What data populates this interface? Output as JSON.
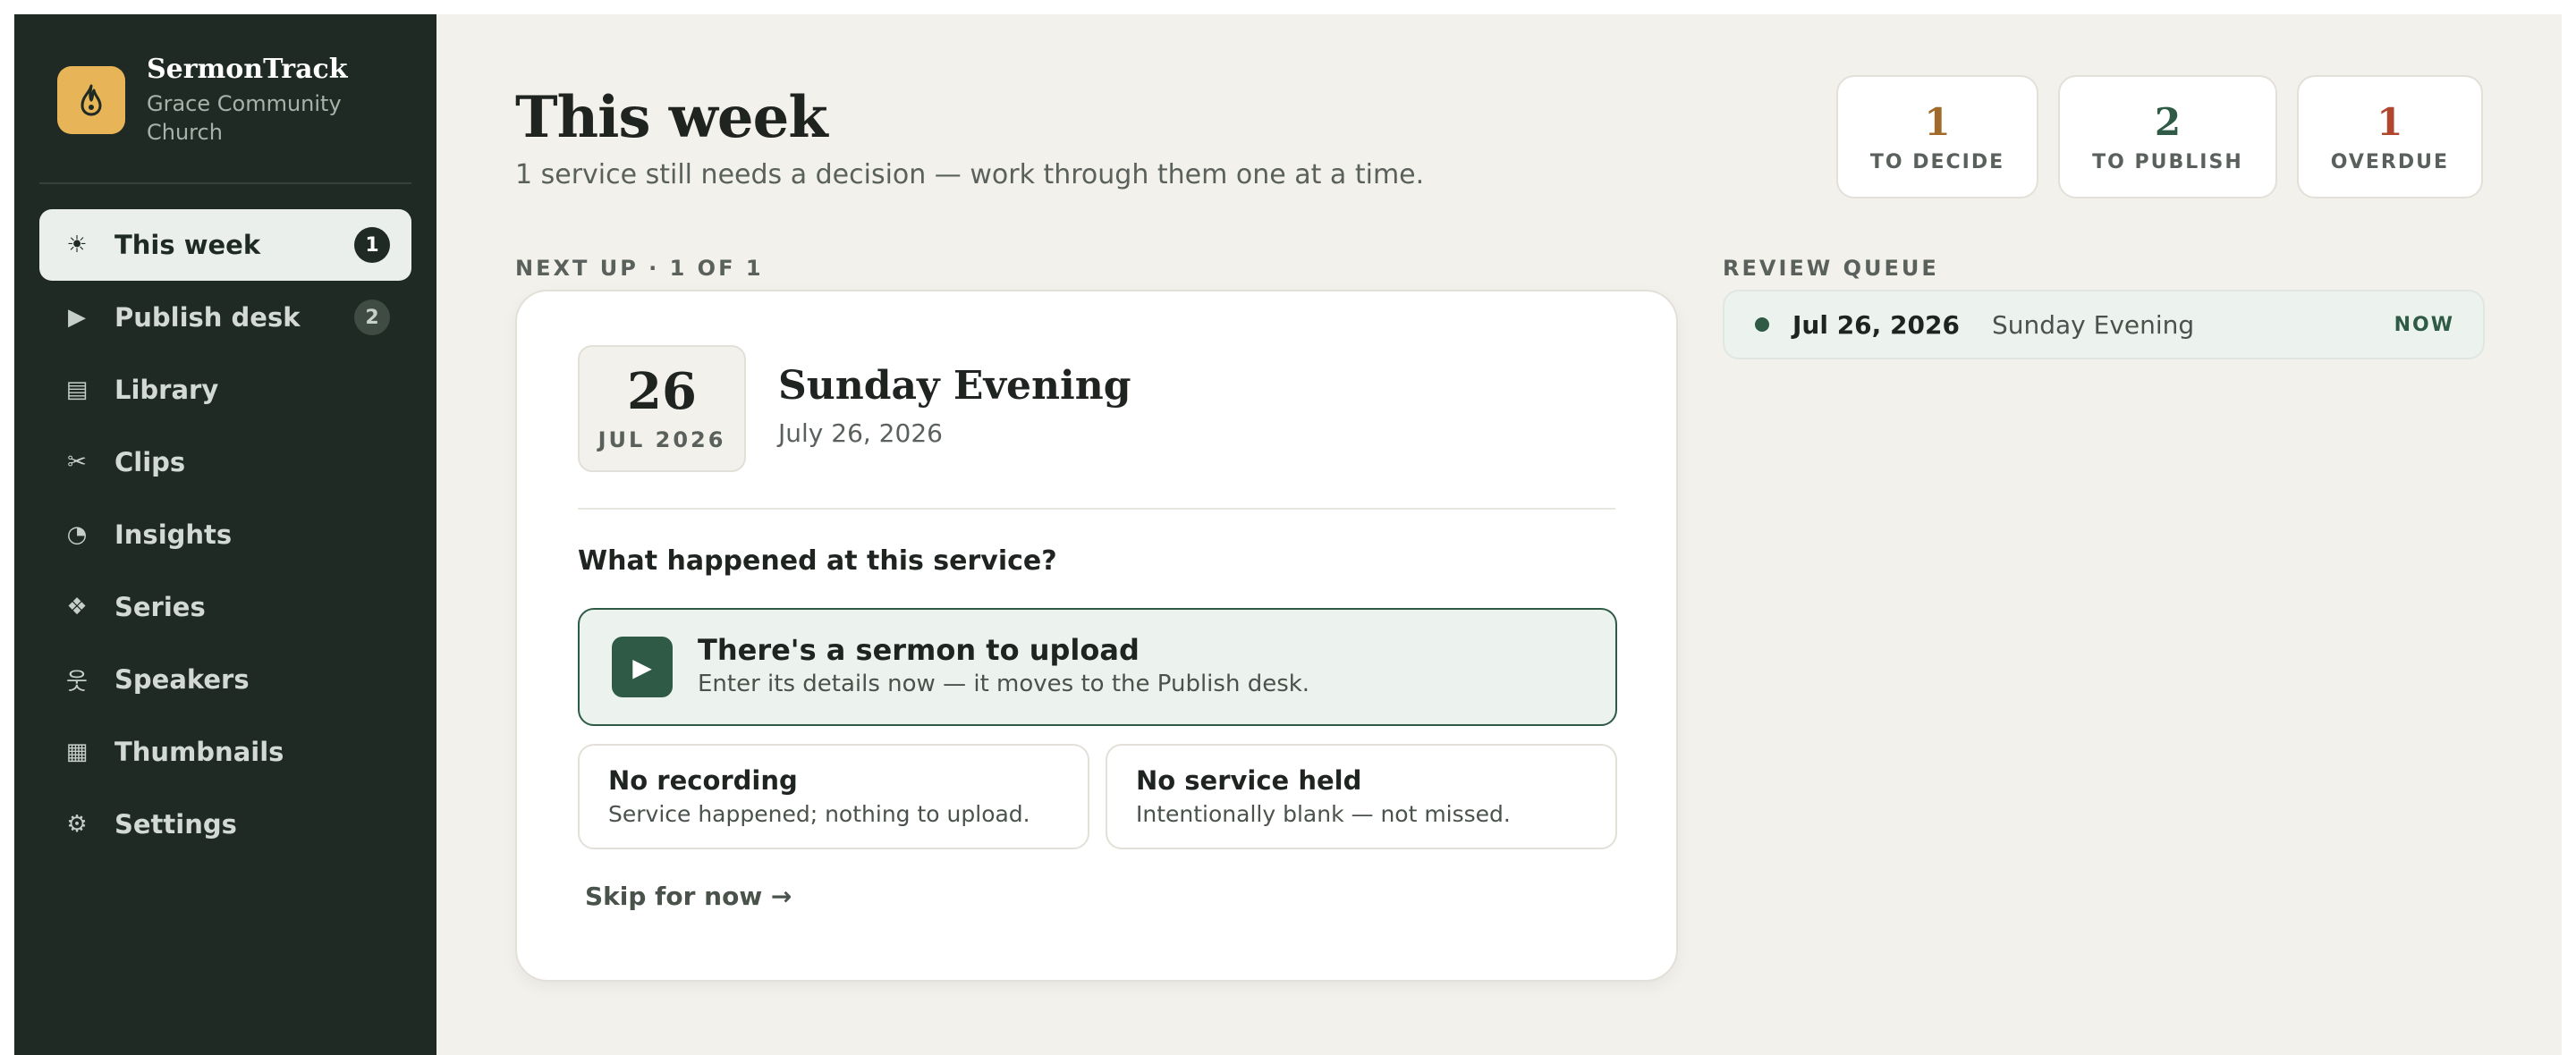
{
  "brand": {
    "name": "SermonTrack",
    "subtitle": "Grace Community Church",
    "logo_icon": "flame-icon",
    "accent": "#e7b457"
  },
  "sidebar": {
    "items": [
      {
        "label": "This week",
        "icon": "sun-icon",
        "glyph": "☀",
        "badge": "1",
        "active": true
      },
      {
        "label": "Publish desk",
        "icon": "play-icon",
        "glyph": "▶",
        "badge": "2"
      },
      {
        "label": "Library",
        "icon": "library-icon",
        "glyph": "▤"
      },
      {
        "label": "Clips",
        "icon": "scissors-icon",
        "glyph": "✂"
      },
      {
        "label": "Insights",
        "icon": "pie-chart-icon",
        "glyph": "◔"
      },
      {
        "label": "Series",
        "icon": "series-icon",
        "glyph": "❖"
      },
      {
        "label": "Speakers",
        "icon": "speaker-icon",
        "glyph": "웃"
      },
      {
        "label": "Thumbnails",
        "icon": "grid-icon",
        "glyph": "▦"
      },
      {
        "label": "Settings",
        "icon": "gear-icon",
        "glyph": "⚙"
      }
    ]
  },
  "header": {
    "title": "This week",
    "subtitle": "1 service still needs a decision — work through them one at a time."
  },
  "stats": [
    {
      "value": "1",
      "label": "TO DECIDE",
      "color": "#a06a2a"
    },
    {
      "value": "2",
      "label": "TO PUBLISH",
      "color": "#2e5a46"
    },
    {
      "value": "1",
      "label": "OVERDUE",
      "color": "#b0462e"
    }
  ],
  "next_up": {
    "label": "NEXT UP · 1 OF 1",
    "day": "26",
    "month_year": "JUL 2026",
    "service_name": "Sunday Evening",
    "service_date": "July 26, 2026",
    "question": "What happened at this service?",
    "primary_option": {
      "title": "There's a sermon to upload",
      "description": "Enter its details now — it moves to the Publish desk.",
      "icon": "play-icon",
      "glyph": "▶"
    },
    "secondary_options": [
      {
        "title": "No recording",
        "description": "Service happened; nothing to upload."
      },
      {
        "title": "No service held",
        "description": "Intentionally blank — not missed."
      }
    ],
    "skip_label": "Skip for now →"
  },
  "review_queue": {
    "label": "REVIEW QUEUE",
    "items": [
      {
        "date": "Jul 26, 2026",
        "name": "Sunday Evening",
        "tag": "NOW"
      }
    ]
  }
}
